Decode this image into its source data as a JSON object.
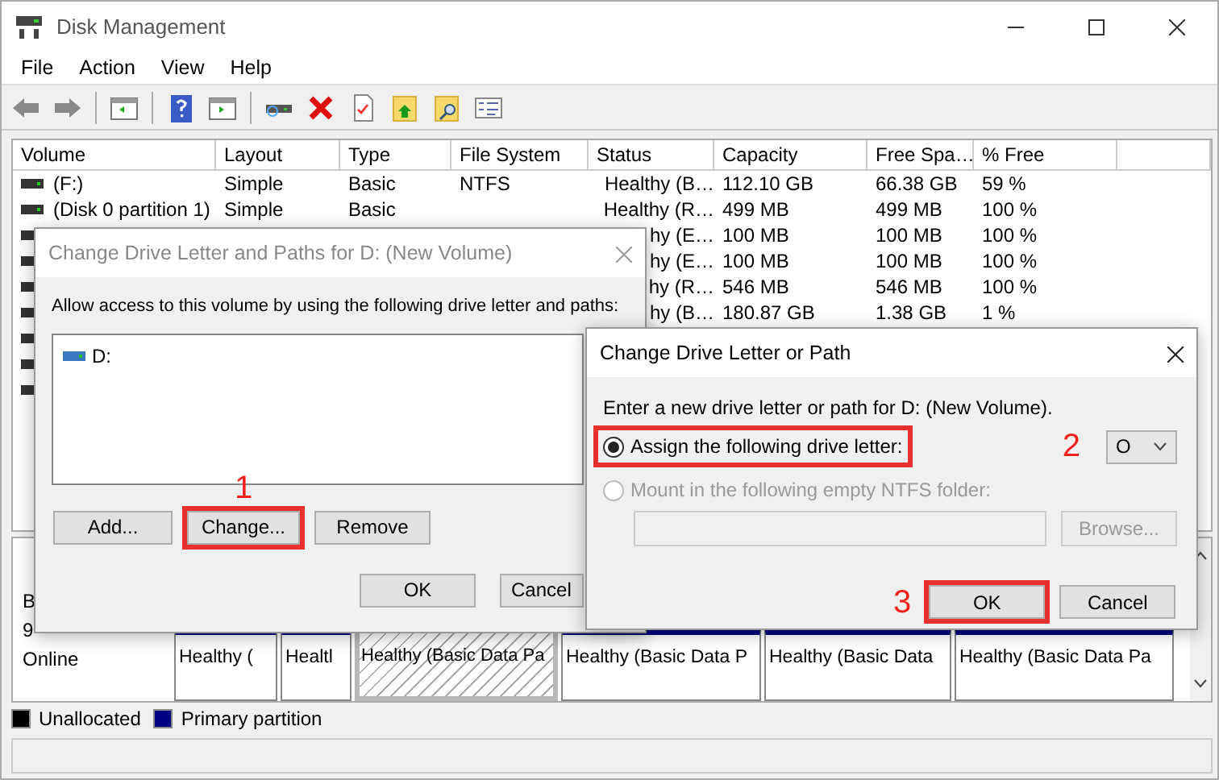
{
  "window": {
    "title": "Disk Management"
  },
  "menu": [
    "File",
    "Action",
    "View",
    "Help"
  ],
  "volume_list": {
    "columns": [
      "Volume",
      "Layout",
      "Type",
      "File System",
      "Status",
      "Capacity",
      "Free Spa…",
      "% Free"
    ],
    "rows": [
      {
        "volume": "(F:)",
        "layout": "Simple",
        "type": "Basic",
        "file_system": "NTFS",
        "status": "Healthy (B…",
        "capacity": "112.10 GB",
        "free": "66.38 GB",
        "percent_free": "59 %"
      },
      {
        "volume": "(Disk 0 partition 1)",
        "layout": "Simple",
        "type": "Basic",
        "status": "Healthy (R…",
        "capacity": "499 MB",
        "free": "499 MB",
        "percent_free": "100 %"
      },
      {
        "status": "hy (E…",
        "capacity": "100 MB",
        "free": "100 MB",
        "percent_free": "100 %"
      },
      {
        "status": "hy (E…",
        "capacity": "100 MB",
        "free": "100 MB",
        "percent_free": "100 %"
      },
      {
        "status": "hy (R…",
        "capacity": "546 MB",
        "free": "546 MB",
        "percent_free": "100 %"
      },
      {
        "status": "hy (B…",
        "capacity": "180.87 GB",
        "free": "1.38 GB",
        "percent_free": "1 %"
      },
      {},
      {},
      {}
    ]
  },
  "disk_map": {
    "disk_info": [
      "B",
      "9",
      "Online"
    ],
    "partitions": [
      {
        "status": "Healthy (",
        "kind": "plain"
      },
      {
        "status": "Healtl",
        "kind": "plain"
      },
      {
        "status": "Healthy (Basic Data Pa",
        "kind": "hatched"
      },
      {
        "status": "Healthy (Basic Data P",
        "kind": "plain"
      },
      {
        "status": "Healthy (Basic Data",
        "kind": "plain"
      },
      {
        "status": "Healthy (Basic Data Pa",
        "kind": "plain"
      }
    ]
  },
  "legend": [
    {
      "label": "Unallocated",
      "color": "#000000"
    },
    {
      "label": "Primary partition",
      "color": "#000080"
    }
  ],
  "paths_dialog": {
    "title": "Change Drive Letter and Paths for D: (New Volume)",
    "active": false,
    "prompt": "Allow access to this volume by using the following drive letter and paths:",
    "paths": [
      "D:"
    ],
    "buttons": [
      {
        "label": "Add...",
        "highlighted": false
      },
      {
        "label": "Change...",
        "highlighted": true,
        "step": "1"
      },
      {
        "label": "Remove",
        "highlighted": false
      }
    ],
    "footer_buttons": [
      "OK",
      "Cancel"
    ]
  },
  "change_dialog": {
    "title": "Change Drive Letter or Path",
    "active": true,
    "prompt": "Enter a new drive letter or path for D: (New Volume).",
    "options": [
      {
        "label": "Assign the following drive letter:",
        "selected": true,
        "disabled": false,
        "highlighted": true
      },
      {
        "label": "Mount in the following empty NTFS folder:",
        "selected": false,
        "disabled": true,
        "highlighted": false
      }
    ],
    "drive_letter": {
      "value": "O",
      "step": "2"
    },
    "browse_button": {
      "label": "Browse...",
      "disabled": true
    },
    "buttons": [
      {
        "label": "OK",
        "highlighted": true,
        "step": "3"
      },
      {
        "label": "Cancel",
        "highlighted": false
      }
    ]
  }
}
